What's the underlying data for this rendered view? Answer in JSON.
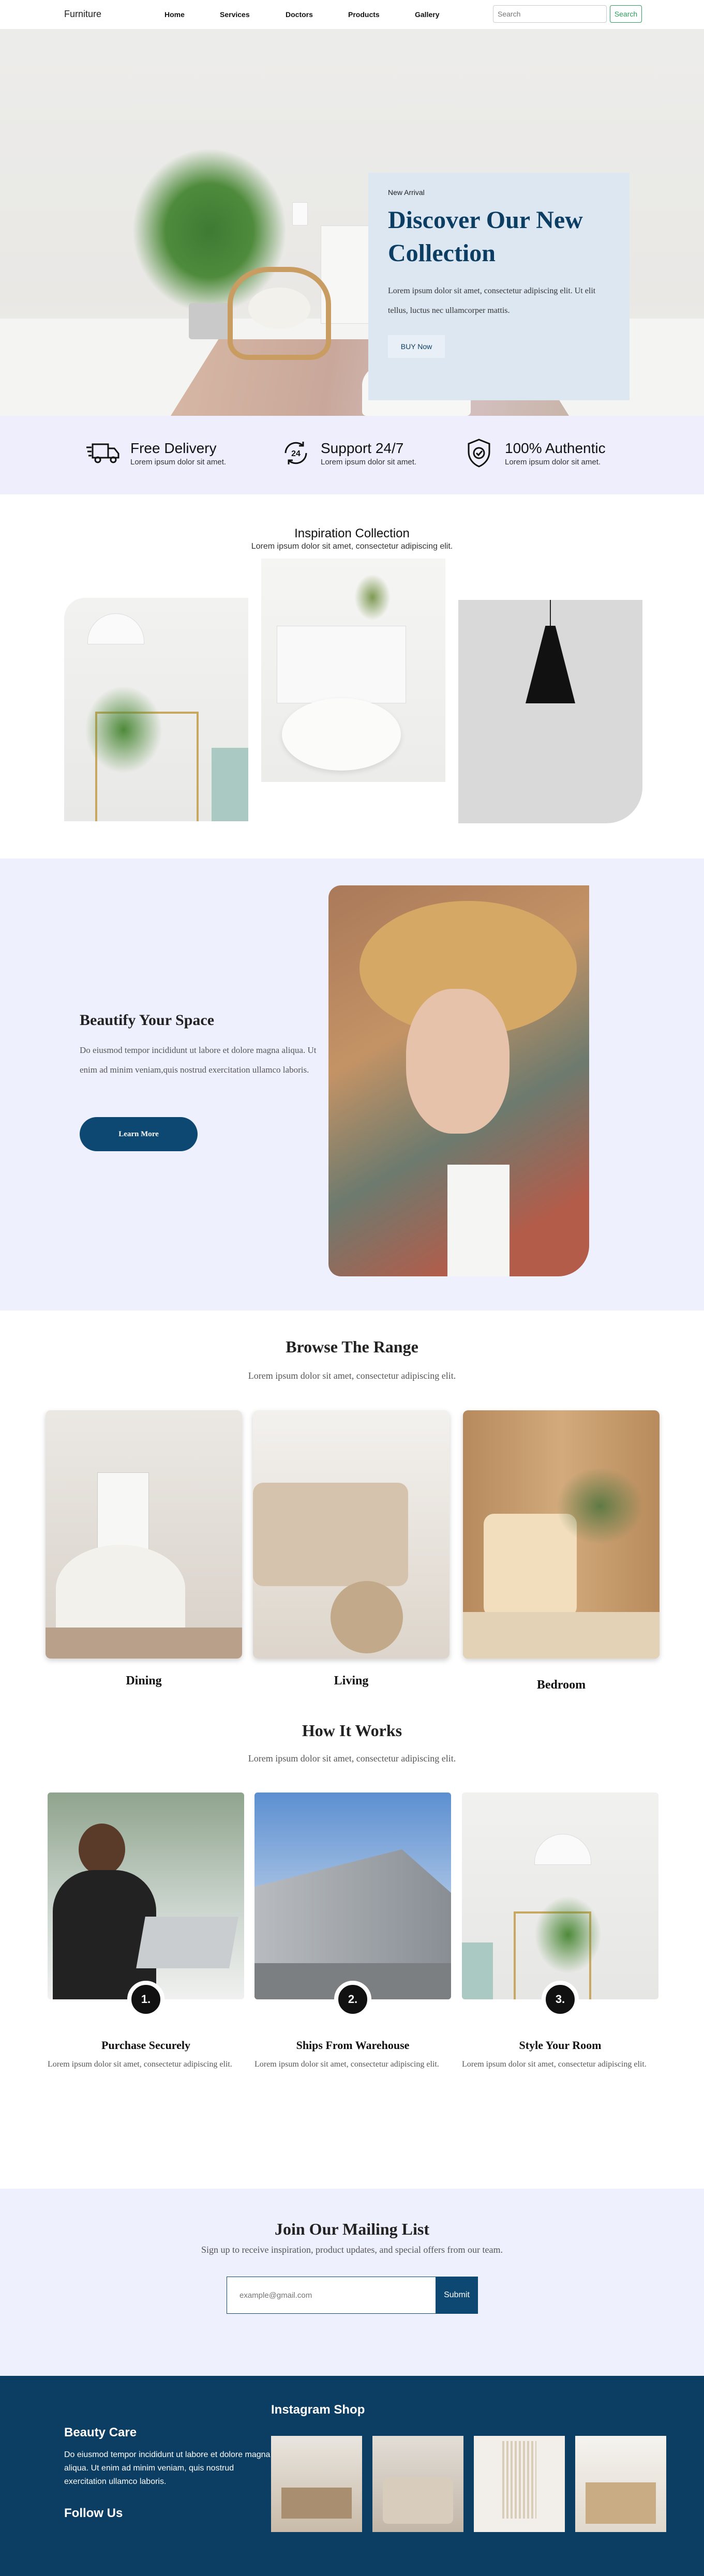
{
  "nav": {
    "brand": "Furniture",
    "links": [
      "Home",
      "Services",
      "Doctors",
      "Products",
      "Gallery"
    ],
    "search_placeholder": "Search",
    "search_button": "Search"
  },
  "hero": {
    "eyebrow": "New Arrival",
    "title": "Discover Our New Collection",
    "text": "Lorem ipsum dolor sit amet, consectetur adipiscing elit. Ut elit tellus, luctus nec ullamcorper mattis.",
    "button": "BUY Now"
  },
  "features": [
    {
      "icon": "truck-icon",
      "title": "Free Delivery",
      "text": "Lorem ipsum dolor sit amet."
    },
    {
      "icon": "support-24-icon",
      "title": "Support 24/7",
      "text": "Lorem ipsum dolor sit amet."
    },
    {
      "icon": "shield-check-icon",
      "title": "100% Authentic",
      "text": "Lorem ipsum dolor sit amet."
    }
  ],
  "inspiration": {
    "title": "Inspiration Collection",
    "subtitle": "Lorem ipsum dolor sit amet, consectetur adipiscing elit."
  },
  "beautify": {
    "title": "Beautify Your Space",
    "text": "Do eiusmod tempor incididunt ut labore et dolore magna aliqua. Ut enim ad minim veniam,quis nostrud exercitation ullamco laboris.",
    "button": "Learn More"
  },
  "browse": {
    "title": "Browse The Range",
    "subtitle": "Lorem ipsum dolor sit amet, consectetur adipiscing elit.",
    "items": [
      "Dining",
      "Living",
      "Bedroom"
    ]
  },
  "how": {
    "title": "How It Works",
    "subtitle": "Lorem ipsum dolor sit amet, consectetur adipiscing elit.",
    "steps": [
      {
        "num": "1.",
        "title": "Purchase Securely",
        "text": "Lorem ipsum dolor sit amet, consectetur adipiscing elit."
      },
      {
        "num": "2.",
        "title": "Ships From Warehouse",
        "text": "Lorem ipsum dolor sit amet, consectetur adipiscing elit."
      },
      {
        "num": "3.",
        "title": "Style Your Room",
        "text": "Lorem ipsum dolor sit amet, consectetur adipiscing elit."
      }
    ]
  },
  "mailing": {
    "title": "Join Our Mailing List",
    "subtitle": "Sign up to receive inspiration, product updates, and special offers from our team.",
    "placeholder": "example@gmail.com",
    "button": "Submit"
  },
  "footer": {
    "brand": "Beauty Care",
    "text": "Do eiusmod tempor incididunt ut labore et dolore magna aliqua. Ut enim ad minim veniam, quis nostrud exercitation ullamco laboris.",
    "follow": "Follow Us",
    "instagram_title": "Instagram Shop"
  },
  "colors": {
    "navy": "#0c3d63",
    "lavender": "#eff0fe",
    "hero_card": "#dde7f2",
    "accent_green": "#2a9d5a"
  }
}
